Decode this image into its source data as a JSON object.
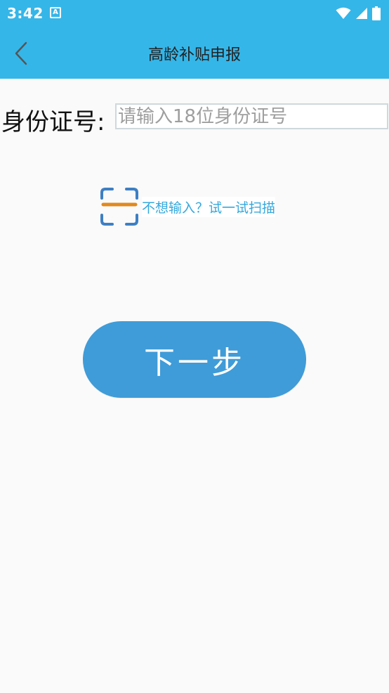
{
  "status_bar": {
    "time": "3:42",
    "notification_icon": "font-a-icon",
    "right_icons": [
      "wifi-icon",
      "signal-icon",
      "battery-icon"
    ]
  },
  "toolbar": {
    "title": "高龄补贴申报",
    "back_icon": "chevron-left-icon"
  },
  "form": {
    "id_label": "身份证号:",
    "id_input": {
      "value": "",
      "placeholder": "请输入18位身份证号"
    }
  },
  "scan": {
    "icon": "scan-icon",
    "text": "不想输入？试一试扫描"
  },
  "next_button": {
    "label": "下一步"
  },
  "colors": {
    "header_bg": "#35b6e8",
    "button_bg": "#3f9cd8",
    "link_text": "#35a8dc",
    "scan_frame": "#3d7fc4",
    "scan_line": "#e08a1e",
    "background": "#fafafa"
  }
}
